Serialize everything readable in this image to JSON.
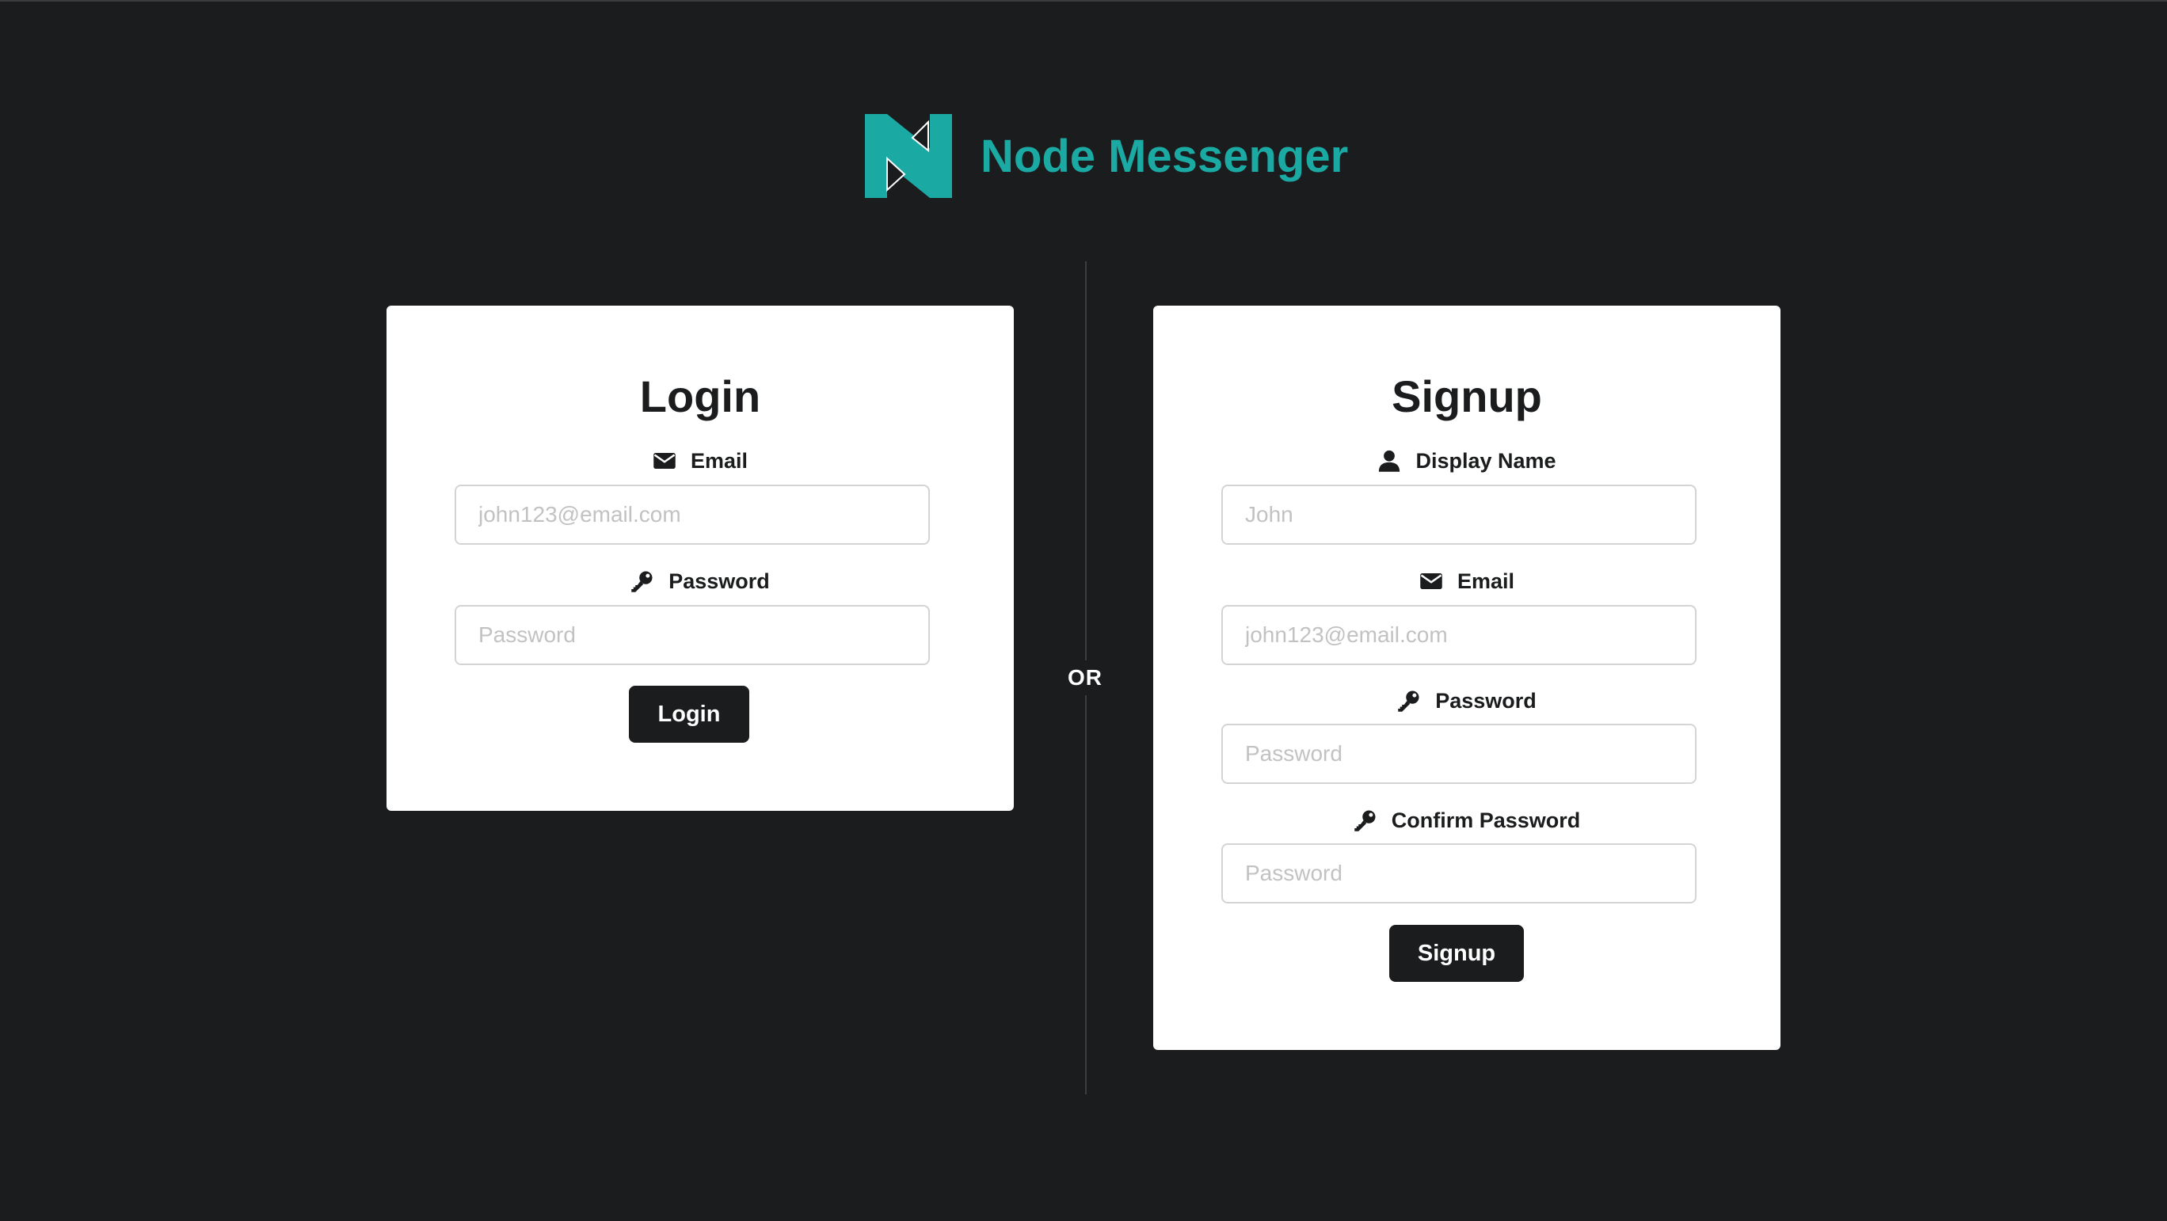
{
  "brand": {
    "name": "Node Messenger",
    "color": "#1aa9a3"
  },
  "divider": {
    "label": "OR"
  },
  "login": {
    "title": "Login",
    "email": {
      "label": "Email",
      "icon": "envelope-icon",
      "placeholder": "john123@email.com",
      "value": ""
    },
    "password": {
      "label": "Password",
      "icon": "key-icon",
      "placeholder": "Password",
      "value": ""
    },
    "submit_label": "Login"
  },
  "signup": {
    "title": "Signup",
    "display_name": {
      "label": "Display Name",
      "icon": "user-icon",
      "placeholder": "John",
      "value": ""
    },
    "email": {
      "label": "Email",
      "icon": "envelope-icon",
      "placeholder": "john123@email.com",
      "value": ""
    },
    "password": {
      "label": "Password",
      "icon": "key-icon",
      "placeholder": "Password",
      "value": ""
    },
    "confirm_password": {
      "label": "Confirm Password",
      "icon": "key-icon",
      "placeholder": "Password",
      "value": ""
    },
    "submit_label": "Signup"
  },
  "colors": {
    "background": "#1b1c1e",
    "card": "#ffffff",
    "button": "#1b1c1d",
    "accent": "#1aa9a3"
  }
}
